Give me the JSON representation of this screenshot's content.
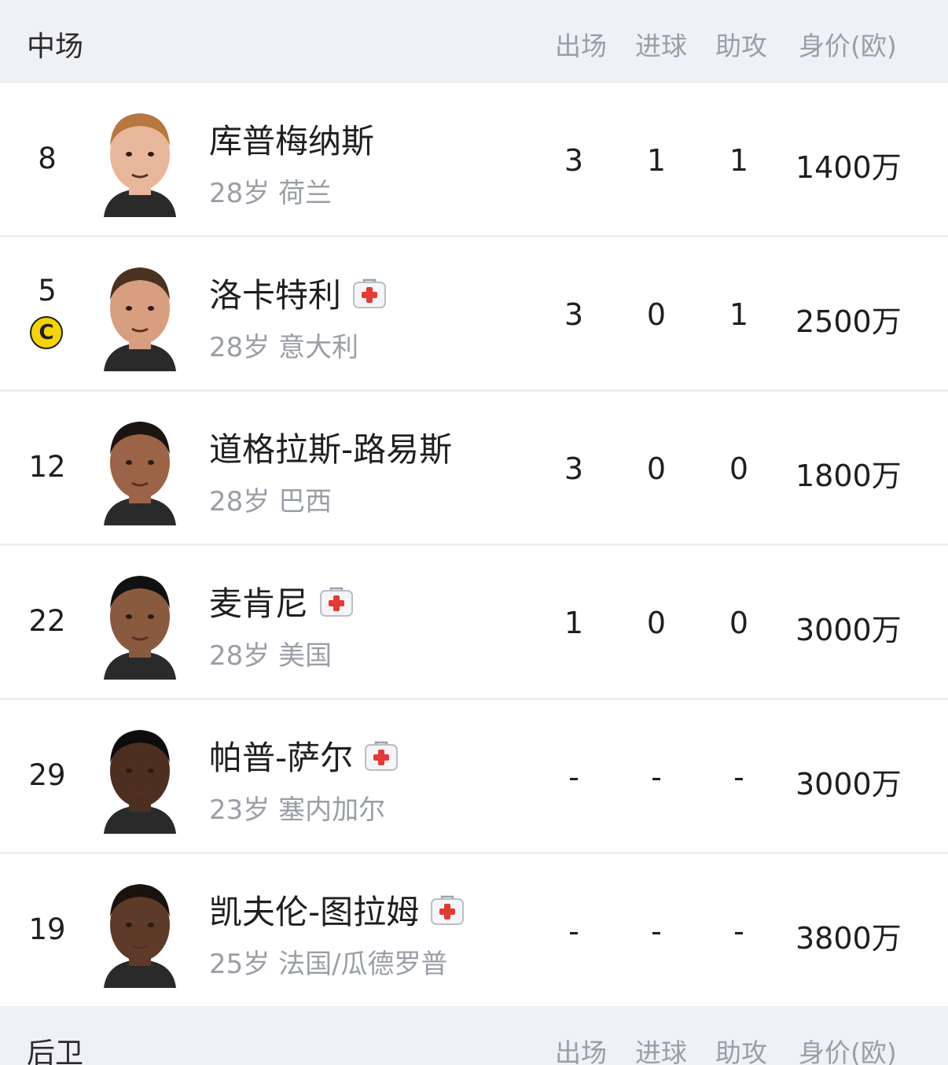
{
  "midfield": {
    "title": "中场",
    "columns": {
      "apps": "出场",
      "goals": "进球",
      "assists": "助攻",
      "value": "身价(欧)"
    },
    "players": [
      {
        "number": "8",
        "name": "库普梅纳斯",
        "age": "28岁",
        "nation": "荷兰",
        "injured": false,
        "captain": false,
        "apps": "3",
        "goals": "1",
        "assists": "1",
        "value": "1400万",
        "skin": "#e8b79b",
        "hair": "#b8773e"
      },
      {
        "number": "5",
        "name": "洛卡特利",
        "age": "28岁",
        "nation": "意大利",
        "injured": true,
        "captain": true,
        "captain_mark": "C",
        "apps": "3",
        "goals": "0",
        "assists": "1",
        "value": "2500万",
        "skin": "#d79f7f",
        "hair": "#4a3220"
      },
      {
        "number": "12",
        "name": "道格拉斯-路易斯",
        "age": "28岁",
        "nation": "巴西",
        "injured": false,
        "captain": false,
        "apps": "3",
        "goals": "0",
        "assists": "0",
        "value": "1800万",
        "skin": "#9b6447",
        "hair": "#1c1410"
      },
      {
        "number": "22",
        "name": "麦肯尼",
        "age": "28岁",
        "nation": "美国",
        "injured": true,
        "captain": false,
        "apps": "1",
        "goals": "0",
        "assists": "0",
        "value": "3000万",
        "skin": "#8a5a3f",
        "hair": "#111111"
      },
      {
        "number": "29",
        "name": "帕普-萨尔",
        "age": "23岁",
        "nation": "塞内加尔",
        "injured": true,
        "captain": false,
        "apps": "-",
        "goals": "-",
        "assists": "-",
        "value": "3000万",
        "skin": "#4d2f22",
        "hair": "#0d0d0d"
      },
      {
        "number": "19",
        "name": "凯夫伦-图拉姆",
        "age": "25岁",
        "nation": "法国/瓜德罗普",
        "injured": true,
        "captain": false,
        "apps": "-",
        "goals": "-",
        "assists": "-",
        "value": "3800万",
        "skin": "#5e3a28",
        "hair": "#1a120d"
      }
    ]
  },
  "defense": {
    "title": "后卫",
    "columns": {
      "apps": "出场",
      "goals": "进球",
      "assists": "助攻",
      "value": "身价(欧)"
    }
  },
  "colors": {
    "header_bg": "#f0f1f4",
    "muted_text": "#9a9ea6",
    "injury_red": "#e53935",
    "captain_yellow": "#f5d400"
  }
}
